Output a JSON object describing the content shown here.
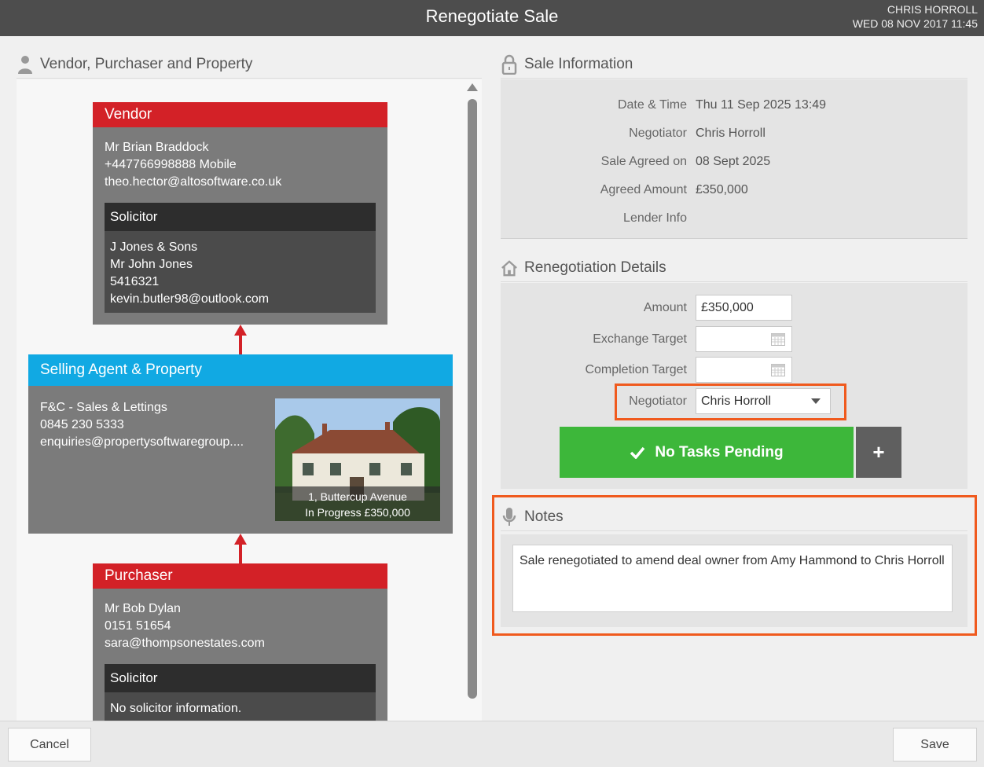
{
  "header": {
    "title": "Renegotiate Sale",
    "user": "CHRIS HORROLL",
    "datetime": "WED 08 NOV 2017 11:45"
  },
  "left_section": {
    "title": "Vendor, Purchaser and Property",
    "icon": "person-icon"
  },
  "vendor": {
    "heading": "Vendor",
    "name": "Mr Brian Braddock",
    "phone": "+447766998888 Mobile",
    "email": "theo.hector@altosoftware.co.uk",
    "solicitor": {
      "heading": "Solicitor",
      "firm": "J Jones & Sons",
      "contact": "Mr John Jones",
      "phone": "5416321",
      "email": "kevin.butler98@outlook.com"
    }
  },
  "agent": {
    "heading": "Selling Agent & Property",
    "name": "F&C - Sales & Lettings",
    "phone": "0845 230 5333",
    "email": "enquiries@propertysoftwaregroup....",
    "property_address": "1, Buttercup Avenue",
    "property_status": "In Progress £350,000"
  },
  "purchaser": {
    "heading": "Purchaser",
    "name": "Mr Bob Dylan",
    "phone": "0151 51654",
    "email": "sara@thompsonestates.com",
    "solicitor": {
      "heading": "Solicitor",
      "info": "No solicitor information."
    }
  },
  "sale_info": {
    "title": "Sale Information",
    "icon": "lock-icon",
    "rows": [
      {
        "label": "Date & Time",
        "value": "Thu 11 Sep 2025 13:49"
      },
      {
        "label": "Negotiator",
        "value": "Chris Horroll"
      },
      {
        "label": "Sale Agreed on",
        "value": "08 Sept 2025"
      },
      {
        "label": "Agreed Amount",
        "value": "£350,000"
      },
      {
        "label": "Lender Info",
        "value": ""
      }
    ]
  },
  "renegotiation": {
    "title": "Renegotiation Details",
    "icon": "home-icon",
    "amount_label": "Amount",
    "amount_value": "£350,000",
    "exchange_label": "Exchange Target",
    "exchange_value": "",
    "completion_label": "Completion Target",
    "completion_value": "",
    "negotiator_label": "Negotiator",
    "negotiator_value": "Chris Horroll",
    "tasks_label": "No Tasks Pending",
    "add_label": "+"
  },
  "notes": {
    "title": "Notes",
    "icon": "microphone-icon",
    "text": "Sale renegotiated to amend deal owner from Amy Hammond to Chris Horroll"
  },
  "footer": {
    "cancel_label": "Cancel",
    "save_label": "Save"
  },
  "colors": {
    "titlebar": "#4d4d4d",
    "vendor_red": "#d32127",
    "agent_blue": "#11a9e3",
    "tasks_green": "#3db73a",
    "highlight_orange": "#f05a1e"
  }
}
